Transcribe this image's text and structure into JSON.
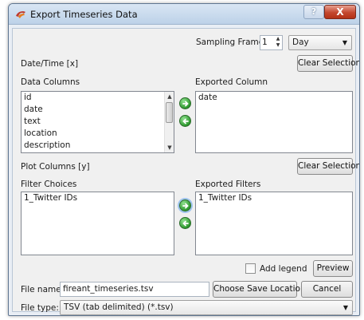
{
  "window": {
    "title": "Export Timeseries Data",
    "help_label": "?",
    "close_label": "X"
  },
  "sampling": {
    "label": "Sampling Frame",
    "value": "1",
    "unit": "Day"
  },
  "datetime": {
    "label": "Date/Time [x]",
    "clear_label": "Clear Selection"
  },
  "data_columns": {
    "label": "Data Columns",
    "items": [
      "id",
      "date",
      "text",
      "location",
      "description"
    ]
  },
  "exported_column": {
    "label": "Exported Column",
    "items": [
      "date"
    ]
  },
  "plot_columns": {
    "label": "Plot Columns [y]",
    "clear_label": "Clear Selection"
  },
  "filter_choices": {
    "label": "Filter Choices",
    "items": [
      "1_Twitter IDs"
    ]
  },
  "exported_filters": {
    "label": "Exported Filters",
    "items": [
      "1_Twitter IDs"
    ]
  },
  "legend": {
    "label": "Add legend",
    "checked": false
  },
  "preview_label": "Preview",
  "file_name": {
    "label": "File name:",
    "value": "fireant_timeseries.tsv"
  },
  "choose_location_label": "Choose Save Location",
  "cancel_label": "Cancel",
  "file_type": {
    "label": "File type:",
    "value": "TSV (tab delimited) (*.tsv)"
  },
  "colors": {
    "titlebar": "#bcd1e8",
    "close_red": "#c4472e",
    "arrow_green": "#2f9a2f"
  }
}
